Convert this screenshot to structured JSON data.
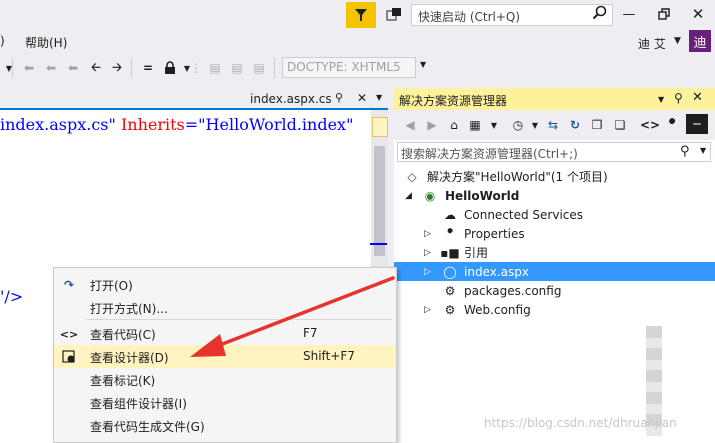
{
  "titlebar": {
    "quick_launch_placeholder": "快速启动 (Ctrl+Q)"
  },
  "menubar": {
    "items": [
      ")",
      "帮助(H)"
    ],
    "user_name": "迪 艾",
    "user_initial": "迪"
  },
  "toolbar": {
    "doctype_value": "DOCTYPE: XHTML5"
  },
  "editor": {
    "tab_label": "index.aspx.cs",
    "code_line1": {
      "part1": "index.aspx.cs\"",
      "part2": " Inherits",
      "part3": "=\"HelloWorld.index\""
    },
    "code_line2": "'/>"
  },
  "solution_explorer": {
    "title": "解决方案资源管理器",
    "search_placeholder": "搜索解决方案资源管理器(Ctrl+;)",
    "tree": [
      {
        "label": "解决方案\"HelloWorld\"(1 个项目)",
        "icon": "solution-icon"
      },
      {
        "label": "HelloWorld",
        "icon": "web-project-icon",
        "bold": true
      },
      {
        "label": "Connected Services",
        "icon": "cloud-icon"
      },
      {
        "label": "Properties",
        "icon": "wrench-icon"
      },
      {
        "label": "引用",
        "icon": "references-icon"
      },
      {
        "label": "index.aspx",
        "icon": "web-page-icon",
        "selected": true
      },
      {
        "label": "packages.config",
        "icon": "config-file-icon"
      },
      {
        "label": "Web.config",
        "icon": "config-file-icon"
      }
    ]
  },
  "context_menu": {
    "items": [
      {
        "label": "打开(O)",
        "shortcut": "",
        "icon": "open-icon"
      },
      {
        "label": "打开方式(N)...",
        "shortcut": "",
        "icon": ""
      },
      {
        "label": "查看代码(C)",
        "shortcut": "F7",
        "icon": "code-icon"
      },
      {
        "label": "查看设计器(D)",
        "shortcut": "Shift+F7",
        "icon": "designer-icon",
        "highlighted": true
      },
      {
        "label": "查看标记(K)",
        "shortcut": "",
        "icon": ""
      },
      {
        "label": "查看组件设计器(I)",
        "shortcut": "",
        "icon": ""
      },
      {
        "label": "查看代码生成文件(G)",
        "shortcut": "",
        "icon": ""
      }
    ]
  },
  "watermark": "https://blog.csdn.net/dhruanjian",
  "colors": {
    "accent": "#007acc",
    "selection": "#3399ff",
    "panel_header": "#fff29d",
    "notify": "#f5c400",
    "annotation_arrow": "#e8322c"
  }
}
